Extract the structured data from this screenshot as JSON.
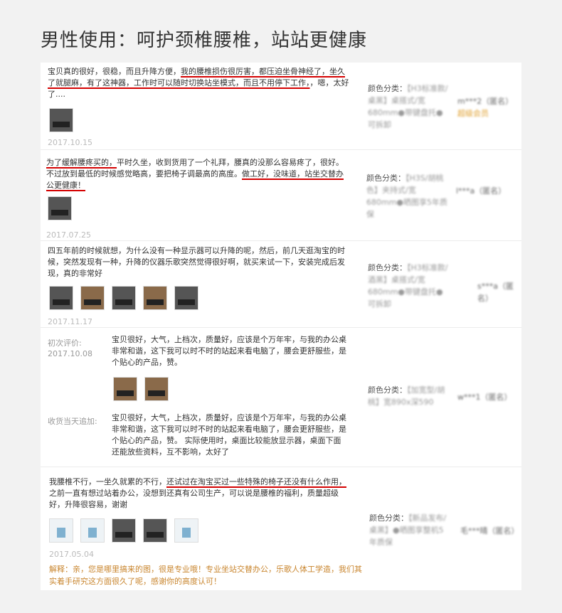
{
  "title": "男性使用：呵护颈椎腰椎，站站更健康",
  "reviews": [
    {
      "text_plain": "宝贝真的很好，很稳，而且升降方便，",
      "text_ul": "我的腰椎损伤很厉害，都压迫坐骨神经了，坐久了就腿麻，有了这神器，工作时可以随时切换站坐模式，而且不用停下工作，",
      "text_tail": "，嗯，太好了....",
      "date": "2017.10.15",
      "meta_label": "颜色分类：",
      "meta_value": "【H3标准款/桌黑】桌搭式/宽680mm●带键盘托●可拆卸",
      "user": "m***2（匿名）",
      "user_badge": "超级会员"
    },
    {
      "text_ul1": "为了缓解腰疼买的，",
      "text_plain": "平时久坐，收到货用了一个礼拜，腰真的没那么容易疼了，很好。不过放到最低的时候感觉略高，要把椅子调最高的高度。",
      "text_ul2": "做工好，没味道，站坐交替办公更健康！",
      "date": "2017.07.25",
      "meta_label": "颜色分类：",
      "meta_value": "【H3S/胡桃色】夹持式/宽680mm●晒图享5年质保",
      "user": "l***a（匿名）"
    },
    {
      "text": "四五年前的时候就想，为什么没有一种显示器可以升降的呢，然后，前几天逛淘宝的时候，突然发现有一种，升降的仪器乐歌突然觉得很好啊，就买来试一下，安装完成后发现，真的非常好",
      "date": "2017.11.17",
      "meta_label": "颜色分类：",
      "meta_value": "【H3标准款/酒黑】桌搭式/宽680mm●带键盘托●可拆卸",
      "user": "s***a（匿名）"
    },
    {
      "first_label": "初次评价:",
      "first_date": "2017.10.08",
      "first_text": "宝贝很好，大气，上档次，质量好，应该是个万年牢，与我的办公桌非常和谐，这下我可以时不时的站起来看电脑了，腰会更舒服些，是个贴心的产品，赞。",
      "append_label": "收货当天追加:",
      "append_text": "宝贝很好，大气，上档次，质量好，应该是个万年牢，与我的办公桌非常和谐，这下我可以时不时的站起来看电脑了，腰会更舒服些，是个贴心的产品，赞。 实际使用时，桌面比较能放显示器，桌面下面还能放些资料，互不影响，太好了",
      "meta_label": "颜色分类：",
      "meta_value": "【加宽型/胡桃】宽890x深590",
      "user": "w***1（匿名）"
    },
    {
      "text_plain": "我腰椎不行，一坐久就累的不行，",
      "text_ul": "还试过在淘宝买过一些特殊的椅子还没有什么作用，",
      "text_tail": "之前一直有想过站着办公，没想到还真有公司生产，可以说是腰椎的福利，质量超级好，升降很容易，谢谢",
      "date": "2017.05.04",
      "meta_label": "颜色分类：",
      "meta_value": "【新品发布/桌黑】●晒图享整机5年质保",
      "user": "毛***晴（匿名）",
      "reply": "解释：亲，您是哪里搞来的图，很是专业哦！专业坐站交替办公，乐歌人体工学造，我们其实着手研究这方面很久了呢，感谢你的高度认可！"
    }
  ]
}
